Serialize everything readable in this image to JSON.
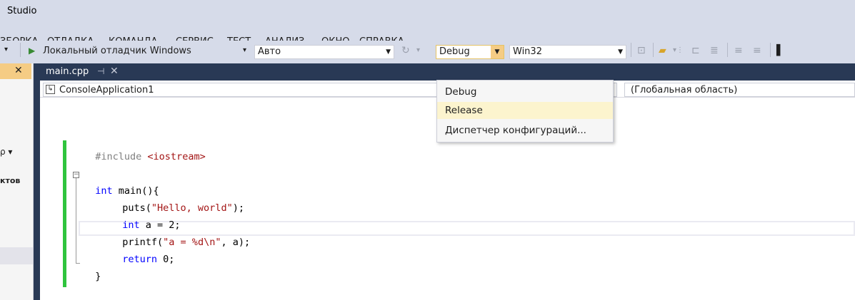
{
  "window": {
    "title": "Studio"
  },
  "menu": {
    "items": [
      "ЗБОРКА",
      "ОТЛАДКА",
      "КОМАНДА",
      "СЕРВИС",
      "ТЕСТ",
      "АНАЛИЗ",
      "ОКНО",
      "СПРАВКА"
    ]
  },
  "toolbar": {
    "start_label": "Локальный отладчик Windows",
    "mode_value": "Авто",
    "config_value": "Debug",
    "platform_value": "Win32"
  },
  "config_dropdown": {
    "options": [
      "Debug",
      "Release",
      "Диспетчер конфигураций..."
    ],
    "highlighted_index": 1
  },
  "left_panel": {
    "partial_label": "ктов"
  },
  "editor": {
    "tab_label": "main.cpp",
    "nav_project": "ConsoleApplication1",
    "nav_scope": "(Глобальная область)",
    "code": {
      "l1_pp": "#include ",
      "l1_inc": "<iostream>",
      "l2_kw": "int",
      "l2_rest": " main(){",
      "l3_fn": "puts(",
      "l3_str": "\"Hello, world\"",
      "l3_end": ");",
      "l4_kw": "int",
      "l4_rest": " a = 2;",
      "l5_fn": "printf(",
      "l5_str": "\"a = %d\\n\"",
      "l5_end": ", a);",
      "l6_kw": "return",
      "l6_rest": " 0;",
      "l7": "}"
    }
  },
  "colors": {
    "chrome": "#d6dbe9",
    "dark_tab": "#293955",
    "accent_combo": "#f5cc84",
    "highlight": "#fcf4ce",
    "change_bar": "#2fc43d"
  }
}
